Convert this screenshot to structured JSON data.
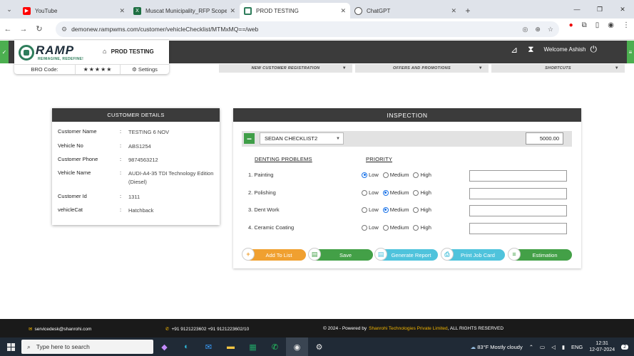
{
  "browser": {
    "tabs": [
      {
        "title": "YouTube",
        "icon_color": "#ff0000",
        "active": false
      },
      {
        "title": "Muscat Municipality_RFP Scope",
        "icon_color": "#1d6f42",
        "active": false
      },
      {
        "title": "PROD TESTING",
        "icon_color": "#2e7d5b",
        "active": true
      },
      {
        "title": "ChatGPT",
        "icon_color": "#555555",
        "active": false
      }
    ],
    "url": "demonew.rampwms.com/customer/vehicleChecklist/MTMxMQ==/web"
  },
  "app": {
    "logo_word": "RAMP",
    "logo_slogan": "REIMAGINE, REDEFINE!",
    "page_name": "PROD TESTING",
    "bro_code_label": "BRO Code:",
    "stars": "★★★★★",
    "settings_label": "Settings",
    "welcome_label": "Welcome",
    "user_name": "Ashish",
    "menus": [
      {
        "label": "NEW CUSTOMER REGISTRATION"
      },
      {
        "label": "OFFERS AND PROMOTIONS"
      },
      {
        "label": "SHORTCUTS"
      }
    ]
  },
  "customer": {
    "title": "CUSTOMER DETAILS",
    "fields": [
      {
        "key": "Customer Name",
        "value": "TESTING 6 NOV"
      },
      {
        "key": "Vehicle No",
        "value": "ABS1254"
      },
      {
        "key": "Customer Phone",
        "value": "9874563212"
      },
      {
        "key": "Vehicle Name",
        "value": "AUDI-A4-35 TDI Technology Edition (Diesel)"
      },
      {
        "key": "Customer Id",
        "value": "1311"
      },
      {
        "key": "vehicleCat",
        "value": "Hatchback"
      }
    ]
  },
  "inspection": {
    "title": "INSPECTION",
    "checklist": "SEDAN CHECKLIST2",
    "amount": "5000.00",
    "col_problems": "DENTING PROBLEMS",
    "col_priority": "PRIORITY",
    "priority_options": [
      "Low",
      "Medium",
      "High"
    ],
    "problems": [
      {
        "label": "1. Painting",
        "selected": "Low"
      },
      {
        "label": "2. Polishing",
        "selected": "Medium"
      },
      {
        "label": "3. Dent Work",
        "selected": "Medium"
      },
      {
        "label": "4. Ceramic Coating",
        "selected": ""
      }
    ],
    "buttons": [
      {
        "label": "Add To List",
        "color": "#f0a030",
        "icon": "+"
      },
      {
        "label": "Save",
        "color": "#43a047",
        "icon": "▤"
      },
      {
        "label": "Generate Report",
        "color": "#4fc3dc",
        "icon": "▤"
      },
      {
        "label": "Print Job Card",
        "color": "#4fc3dc",
        "icon": "⎙"
      },
      {
        "label": "Estimation",
        "color": "#43a047",
        "icon": "≡"
      }
    ]
  },
  "footer": {
    "email": "servicedesk@shanrohi.com",
    "phones": "+91 9121223602  +91 9121223602/10",
    "copyright_prefix": "© 2024 - Powered by",
    "company": "Shanrohi Technologies Private Limited",
    "rights": ", ALL RIGHTS RESERVED"
  },
  "taskbar": {
    "search_placeholder": "Type here to search",
    "weather": "83°F  Mostly cloudy",
    "lang": "ENG",
    "time": "12:31",
    "date": "12-07-2024",
    "notifications": "2",
    "badge": "8"
  }
}
